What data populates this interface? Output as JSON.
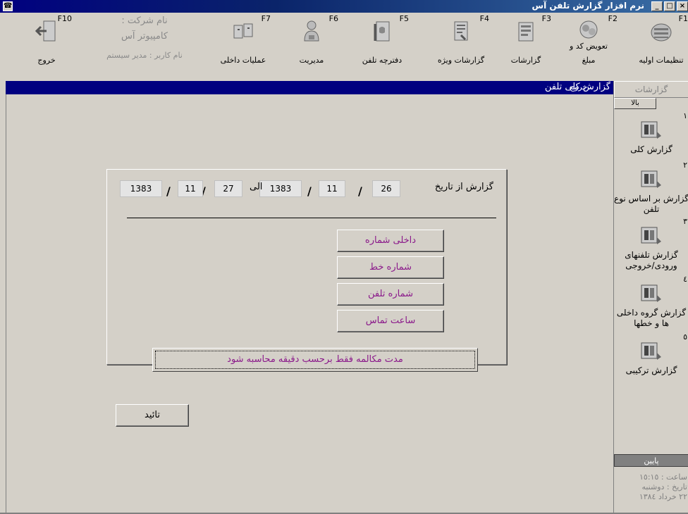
{
  "window": {
    "title": "نرم افزار گزارش تلفن آس",
    "min": "_",
    "max": "□",
    "close": "×"
  },
  "toolbar": [
    {
      "key": "F1",
      "label": "تنظیمات اولیه"
    },
    {
      "key": "F2",
      "label": "مبلغ",
      "label_top": "تعویض کد و"
    },
    {
      "key": "F3",
      "label": "گزارشات"
    },
    {
      "key": "F4",
      "label": "گزارشات ویژه"
    },
    {
      "key": "F5",
      "label": "دفترچه تلفن"
    },
    {
      "key": "F6",
      "label": "مدیریت"
    },
    {
      "key": "F7",
      "label": "عملیات داخلی"
    },
    {
      "key": "F10",
      "label": "خروج"
    }
  ],
  "company": {
    "name_label": "نام شرکت :",
    "name": "کامپیوتر آس",
    "user": "نام کاربر : مدیر سیستم"
  },
  "header": {
    "title": "گزارش کلی تلفن",
    "exit": "خروج"
  },
  "sidebar": {
    "heading": "گزارشات",
    "up": "بالا",
    "down": "پایین",
    "items": [
      {
        "num": "۱",
        "label": "گزارش کلی"
      },
      {
        "num": "۲",
        "label": "گزارش بر اساس نوع تلفن"
      },
      {
        "num": "۳",
        "label": "گزارش تلفنهای ورودی/خروجی"
      },
      {
        "num": "٤",
        "label": "گزارش گروه داخلی ها و خطها"
      },
      {
        "num": "٥",
        "label": "گزارش ترکیبی"
      }
    ],
    "time": "ساعت : ١٥:١٥",
    "date_label": "تاریخ : دوشنبه",
    "date": "٢٢ خرداد ١٣٨٤"
  },
  "form": {
    "from_label": "گزارش از تاریخ",
    "to_label": "الی",
    "from": {
      "day": "26",
      "month": "11",
      "year": "1383"
    },
    "to": {
      "day": "27",
      "month": "11",
      "year": "1383"
    },
    "slash": "/",
    "options": [
      "داخلی شماره",
      "شماره خط",
      "شماره تلفن",
      "ساعت تماس"
    ],
    "minute_calc": "مدت مکالمه فقط برحسب دقیقه محاسبه شود",
    "ok": "تائید"
  },
  "colors": {
    "title_bar": "#000080",
    "option_text": "#8b1a8b",
    "face": "#d4d0c8"
  }
}
